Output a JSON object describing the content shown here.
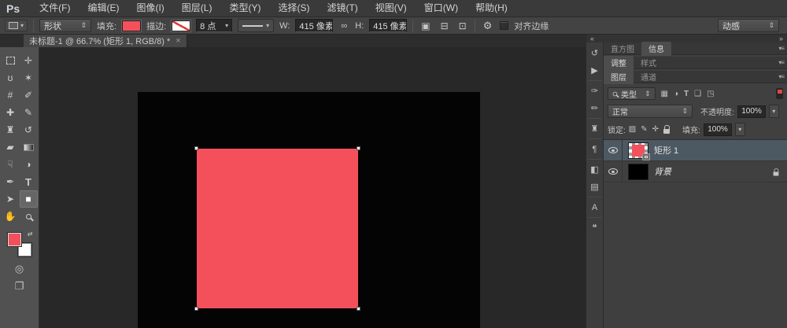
{
  "app": {
    "logo": "Ps",
    "workspace": "动感"
  },
  "menubar": {
    "items": [
      "文件(F)",
      "编辑(E)",
      "图像(I)",
      "图层(L)",
      "类型(Y)",
      "选择(S)",
      "滤镜(T)",
      "视图(V)",
      "窗口(W)",
      "帮助(H)"
    ]
  },
  "options": {
    "tool_mode": "形状",
    "fill_label": "填充:",
    "stroke_label": "描边:",
    "stroke_width": "8 点",
    "w_label": "W:",
    "w_value": "415 像素",
    "link_icon": "∞",
    "h_label": "H:",
    "h_value": "415 像素",
    "path_ops_icon": "▣",
    "path_align_icon": "⊟",
    "path_arrange_icon": "⊡",
    "gear_icon": "⚙",
    "align_edges_label": "对齐边缘"
  },
  "document_tab": {
    "title": "未标题-1 @ 66.7% (矩形 1, RGB/8) *",
    "close": "×"
  },
  "colors": {
    "accent_red": "#f4505c",
    "foreground": "#f4505c",
    "background_swatch": "#ffffff",
    "canvas": "#000000",
    "selected_layer_row": "#4d5962"
  },
  "tools": [
    {
      "name": "rectangular-marquee-tool",
      "glyph": ""
    },
    {
      "name": "move-tool",
      "glyph": "✛"
    },
    {
      "name": "lasso-tool",
      "glyph": "ʊ"
    },
    {
      "name": "magic-wand-tool",
      "glyph": "✶"
    },
    {
      "name": "crop-tool",
      "glyph": "#"
    },
    {
      "name": "eyedropper-tool",
      "glyph": "✐"
    },
    {
      "name": "healing-brush-tool",
      "glyph": "✚"
    },
    {
      "name": "brush-tool",
      "glyph": "✎"
    },
    {
      "name": "clone-stamp-tool",
      "glyph": "♜"
    },
    {
      "name": "history-brush-tool",
      "glyph": "↺"
    },
    {
      "name": "eraser-tool",
      "glyph": "▰"
    },
    {
      "name": "gradient-tool",
      "glyph": ""
    },
    {
      "name": "smudge-tool",
      "glyph": "☟"
    },
    {
      "name": "dodge-tool",
      "glyph": "◑"
    },
    {
      "name": "pen-tool",
      "glyph": "✒"
    },
    {
      "name": "type-tool",
      "glyph": "T"
    },
    {
      "name": "path-selection-tool",
      "glyph": "➤"
    },
    {
      "name": "rectangle-tool",
      "glyph": "■",
      "selected": true
    },
    {
      "name": "hand-tool",
      "glyph": "✋"
    },
    {
      "name": "zoom-tool",
      "glyph": ""
    }
  ],
  "toolbar_extra": {
    "swap_icon": "⇄",
    "quick_mask_icon": "◎",
    "screen_mode_icon": "❐"
  },
  "dock": {
    "collapse_left": "«",
    "collapse_right": "»",
    "panel_menu_icon": "▾≡",
    "icons": [
      {
        "name": "history-panel-icon",
        "glyph": "↺"
      },
      {
        "name": "actions-panel-icon",
        "glyph": "▶"
      },
      {
        "name": "brush-panel-icon",
        "glyph": "✑"
      },
      {
        "name": "brush-presets-panel-icon",
        "glyph": "✏"
      },
      {
        "name": "clone-source-panel-icon",
        "glyph": "♜"
      },
      {
        "name": "paragraph-panel-icon",
        "glyph": "¶"
      },
      {
        "name": "character-styles-panel-icon",
        "glyph": "◧"
      },
      {
        "name": "paragraph-styles-panel-icon",
        "glyph": "▤"
      },
      {
        "name": "character-panel-icon",
        "glyph": "A"
      },
      {
        "name": "notes-panel-icon",
        "glyph": "❝"
      }
    ]
  },
  "panels": {
    "groups": [
      {
        "tabs": [
          {
            "label": "直方图"
          },
          {
            "label": "信息"
          }
        ]
      },
      {
        "tabs": [
          {
            "label": "调整"
          },
          {
            "label": "样式"
          }
        ]
      },
      {
        "tabs": [
          {
            "label": "图层"
          },
          {
            "label": "通道"
          }
        ]
      }
    ],
    "layers": {
      "filter_label": "类型",
      "filter_icons": [
        {
          "name": "filter-pixel-layers-icon",
          "glyph": "▦"
        },
        {
          "name": "filter-adjustment-layers-icon",
          "glyph": "◑"
        },
        {
          "name": "filter-type-layers-icon",
          "glyph": "T"
        },
        {
          "name": "filter-shape-layers-icon",
          "glyph": "❑"
        },
        {
          "name": "filter-smart-objects-icon",
          "glyph": "◳"
        }
      ],
      "blend_mode": "正常",
      "opacity_label": "不透明度:",
      "opacity_value": "100%",
      "lock_label": "锁定:",
      "lock_transparent_icon": "▨",
      "lock_pixels_icon": "✎",
      "lock_position_icon": "✛",
      "fill_label": "填充:",
      "fill_value": "100%",
      "rows": [
        {
          "name": "矩形 1",
          "selected": true
        },
        {
          "name": "背景",
          "selected": false,
          "locked": true
        }
      ]
    }
  }
}
